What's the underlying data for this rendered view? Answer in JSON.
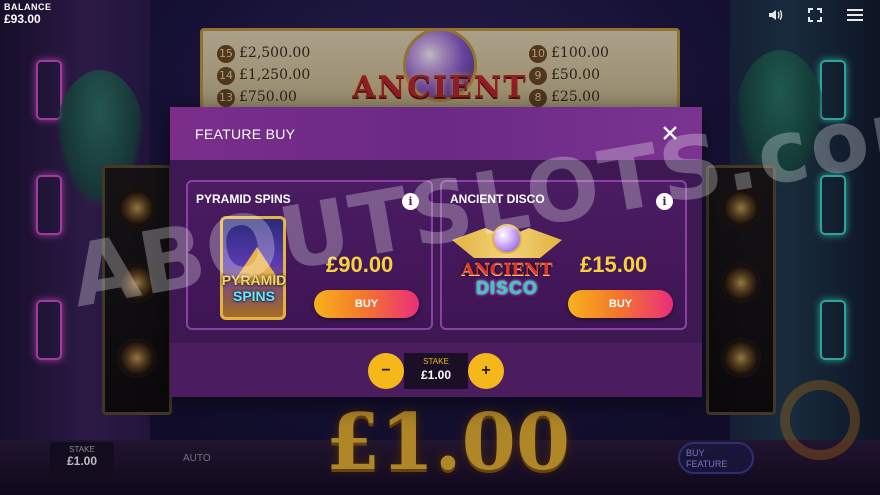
{
  "hud": {
    "balance_label": "BALANCE",
    "balance_value": "£93.00",
    "stake_label": "STAKE",
    "stake_value": "£1.00",
    "auto_label": "AUTO",
    "buy_feature_line1": "BUY",
    "buy_feature_line2": "FEATURE",
    "icons": [
      "speaker-icon",
      "fullscreen-icon",
      "menu-icon"
    ]
  },
  "paytable": {
    "left": [
      {
        "num": "15",
        "prize": "£2,500.00"
      },
      {
        "num": "14",
        "prize": "£1,250.00"
      },
      {
        "num": "13",
        "prize": "£750.00"
      }
    ],
    "right": [
      {
        "num": "10",
        "prize": "£100.00"
      },
      {
        "num": "9",
        "prize": "£50.00"
      },
      {
        "num": "8",
        "prize": "£25.00"
      }
    ]
  },
  "game_logo_text": "ANCIENT",
  "big_stake_display": "£1.00",
  "watermark": "ABOUTSLOTS.com",
  "modal": {
    "title": "FEATURE BUY",
    "close_icon": "close-icon",
    "cards": [
      {
        "title": "PYRAMID SPINS",
        "price": "£90.00",
        "buy_label": "BUY",
        "art_line1": "PYRAMID",
        "art_line2": "SPINS"
      },
      {
        "title": "ANCIENT DISCO",
        "price": "£15.00",
        "buy_label": "BUY",
        "art_line1": "ANCIENT",
        "art_line2": "DISCO"
      }
    ],
    "stake": {
      "label": "STAKE",
      "value": "£1.00",
      "minus": "−",
      "plus": "+"
    }
  },
  "colors": {
    "modal_bg": "#4b1d5e",
    "header_bg": "#7a2e8a",
    "price_yellow": "#f7d23a",
    "button_gradient_start": "#f7b21c",
    "button_gradient_end": "#ea2e7a",
    "stepper_yellow": "#f4b81b"
  }
}
